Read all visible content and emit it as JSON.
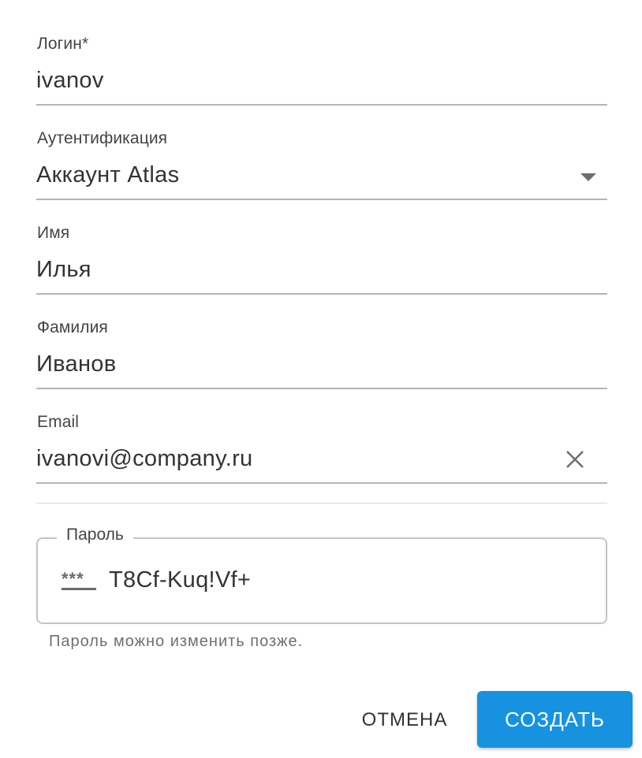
{
  "form": {
    "login": {
      "label": "Логин*",
      "value": "ivanov"
    },
    "auth": {
      "label": "Аутентификация",
      "value": "Аккаунт Atlas",
      "icon": "dropdown-arrow-icon"
    },
    "first_name": {
      "label": "Имя",
      "value": "Илья"
    },
    "last_name": {
      "label": "Фамилия",
      "value": "Иванов"
    },
    "email": {
      "label": "Email",
      "value": "ivanovi@company.ru",
      "clear_icon": "close-icon"
    },
    "password": {
      "label": "Пароль",
      "icon_text": "***",
      "icon": "password-visibility-icon",
      "value": "T8Cf-Kuq!Vf+",
      "helper": "Пароль можно изменить позже."
    }
  },
  "actions": {
    "cancel_label": "ОТМЕНА",
    "create_label": "СОЗДАТЬ"
  },
  "colors": {
    "primary": "#1792e0",
    "text": "#333333",
    "underline": "#b5b5b5"
  }
}
